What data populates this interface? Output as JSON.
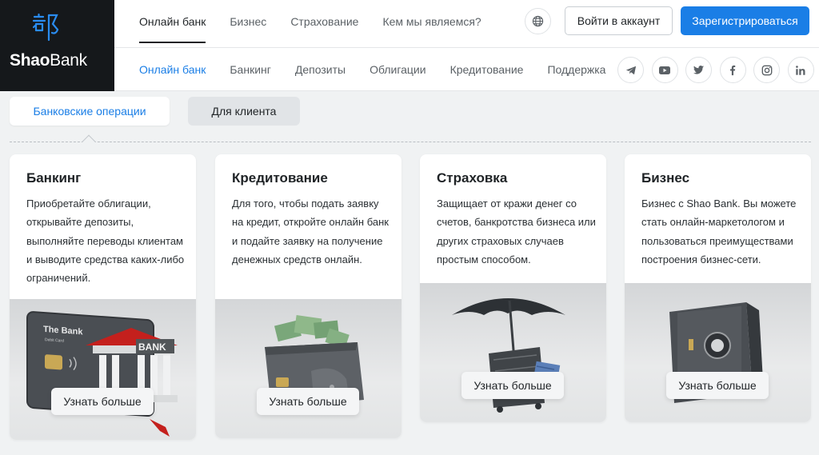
{
  "brand": {
    "name_bold": "Shao",
    "name_regular": "Bank",
    "mark_icon": "kanji-logo-icon"
  },
  "nav_top": [
    {
      "label": "Онлайн банк"
    },
    {
      "label": "Бизнес"
    },
    {
      "label": "Страхование"
    },
    {
      "label": "Кем мы являемся?"
    }
  ],
  "nav_sub": [
    {
      "label": "Онлайн банк"
    },
    {
      "label": "Банкинг"
    },
    {
      "label": "Депозиты"
    },
    {
      "label": "Облигации"
    },
    {
      "label": "Кредитование"
    },
    {
      "label": "Поддержка"
    }
  ],
  "header_actions": {
    "language_icon": "globe-icon",
    "login_label": "Войти в аккаунт",
    "register_label": "Зарегистрироваться"
  },
  "socials": [
    {
      "icon": "telegram-icon",
      "glyph": "➤"
    },
    {
      "icon": "youtube-icon",
      "glyph": "You Tube"
    },
    {
      "icon": "twitter-icon",
      "glyph": "🐦"
    },
    {
      "icon": "facebook-icon",
      "glyph": "f"
    },
    {
      "icon": "instagram-icon",
      "glyph": "◎"
    },
    {
      "icon": "linkedin-icon",
      "glyph": "in"
    }
  ],
  "tabs": [
    {
      "label": "Банковские операции",
      "active": true
    },
    {
      "label": "Для клиента",
      "active": false
    }
  ],
  "cards": [
    {
      "title": "Банкинг",
      "text": "Приобретайте облигации, открывайте депозиты, выполняйте переводы клиентам и выводите средства каких-либо ограничений.",
      "button": "Узнать больше",
      "image_card_title": "The Bank",
      "image_card_sub": "Debit Card",
      "image_bank_label": "BANK"
    },
    {
      "title": "Кредитование",
      "text": "Для того, чтобы подать заявку на кредит, откройте онлайн банк и подайте заявку на получение денежных средств онлайн.",
      "button": "Узнать больше"
    },
    {
      "title": "Страховка",
      "text": "Защищает от кражи денег со счетов, банкротства бизнеса или других страховых случаев простым способом.",
      "button": "Узнать больше"
    },
    {
      "title": "Бизнес",
      "text": "Бизнес с Shao Bank. Вы можете стать онлайн-маркетологом и пользоваться преимуществами построения бизнес-сети.",
      "button": "Узнать больше"
    }
  ],
  "colors": {
    "accent": "#1a7ee6",
    "logo_bg": "#15181b",
    "page_bg": "#f0f2f3"
  }
}
